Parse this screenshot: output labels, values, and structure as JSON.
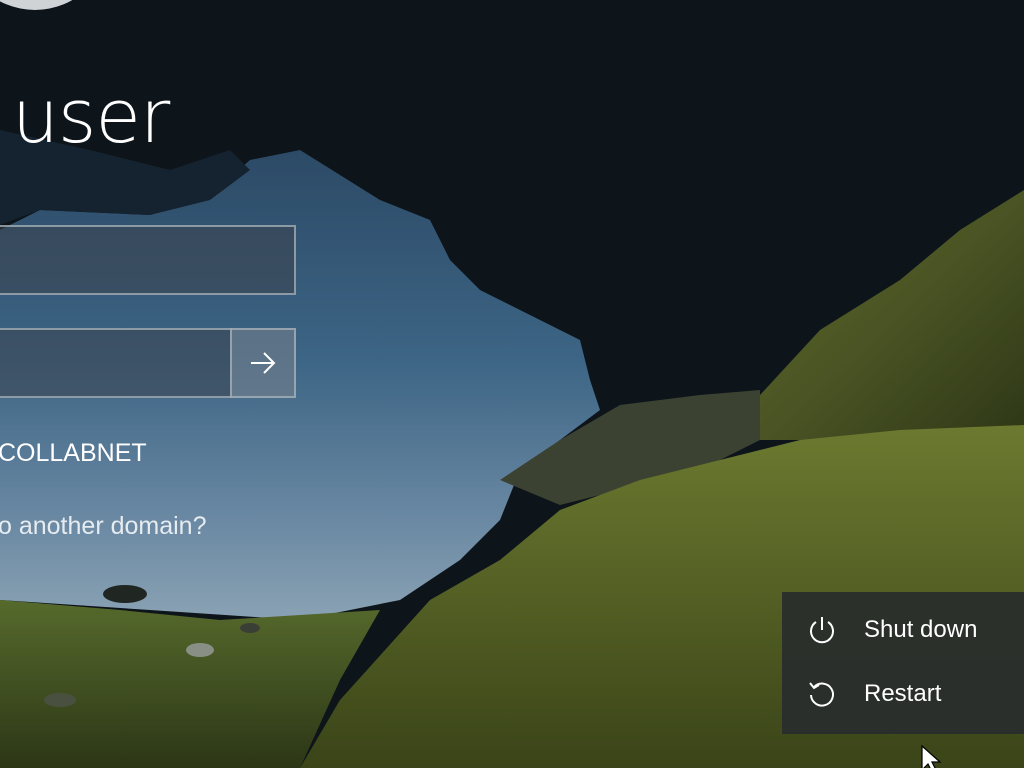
{
  "login": {
    "title": "r user",
    "username": {
      "value": "",
      "placeholder": ""
    },
    "password": {
      "value": "",
      "placeholder": ""
    },
    "submit_icon": "arrow-right-icon",
    "domain_label": "COLLABNET",
    "domain_link": "o another domain?"
  },
  "power_menu": {
    "items": [
      {
        "label": "Shut down",
        "icon": "power-icon"
      },
      {
        "label": "Restart",
        "icon": "restart-icon"
      }
    ]
  },
  "colors": {
    "menu_bg": "#282c2c",
    "field_border": "#aab4bc",
    "text": "#ffffff"
  }
}
